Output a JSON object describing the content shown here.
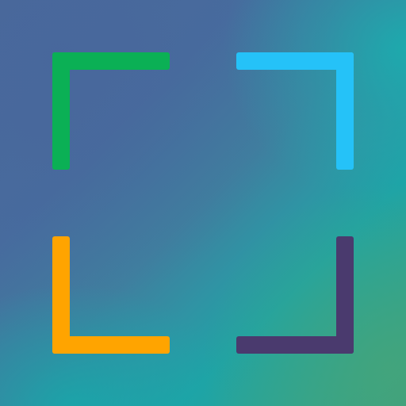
{
  "icon": {
    "name": "fullscreen-frame-icon",
    "corners": [
      {
        "id": "corner-tl",
        "name": "top-left-corner-bracket",
        "color": "#0bb055",
        "orientation": "top-left"
      },
      {
        "id": "corner-tr",
        "name": "top-right-corner-bracket",
        "color": "#25c2f8",
        "orientation": "top-right"
      },
      {
        "id": "corner-bl",
        "name": "bottom-left-corner-bracket",
        "color": "#ffa400",
        "orientation": "bottom-left"
      },
      {
        "id": "corner-br",
        "name": "bottom-right-corner-bracket",
        "color": "#4a3a6e",
        "orientation": "bottom-right"
      }
    ]
  },
  "background": {
    "colors": [
      "#4a6a9b",
      "#1fa3a6",
      "#3e9f80"
    ]
  }
}
